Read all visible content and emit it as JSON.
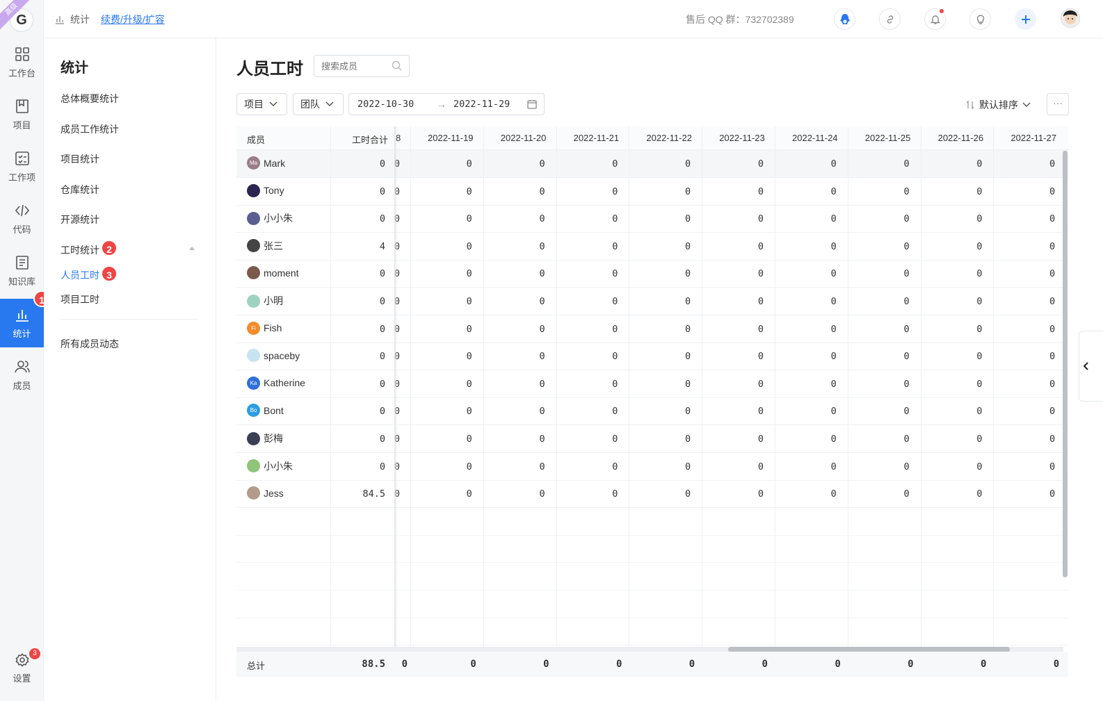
{
  "rail": {
    "badge_ribbon": "高级",
    "logo": "G",
    "items": [
      {
        "label": "工作台",
        "icon": "dashboard-icon"
      },
      {
        "label": "项目",
        "icon": "project-icon"
      },
      {
        "label": "工作项",
        "icon": "task-list-icon"
      },
      {
        "label": "代码",
        "icon": "code-icon"
      },
      {
        "label": "知识库",
        "icon": "document-icon"
      },
      {
        "label": "统计",
        "icon": "bar-chart-icon",
        "active": true
      },
      {
        "label": "成员",
        "icon": "members-icon"
      }
    ],
    "settings_label": "设置",
    "settings_badge": "3",
    "step_badge_1": "1"
  },
  "header": {
    "breadcrumb_label": "统计",
    "upgrade_link": "续费/升级/扩容",
    "qq_group": "售后 QQ 群：732702389"
  },
  "sidebar": {
    "title": "统计",
    "items": [
      "总体概要统计",
      "成员工作统计",
      "项目统计",
      "仓库统计",
      "开源统计",
      "工时统计",
      "人员工时",
      "项目工时",
      "所有成员动态"
    ],
    "step_badge_2": "2",
    "step_badge_3": "3"
  },
  "main": {
    "title": "人员工时",
    "search_placeholder": "搜索成员",
    "filter_project": "项目",
    "filter_team": "团队",
    "date_start": "2022-10-30",
    "date_arrow": "→",
    "date_end": "2022-11-29",
    "sort_label": "默认排序",
    "more_label": "···"
  },
  "table": {
    "col_member": "成员",
    "col_total": "工时合计",
    "partial_col": "8",
    "dates": [
      "2022-11-19",
      "2022-11-20",
      "2022-11-21",
      "2022-11-22",
      "2022-11-23",
      "2022-11-24",
      "2022-11-25",
      "2022-11-26",
      "2022-11-27"
    ],
    "rows": [
      {
        "name": "Mark",
        "avatar": "Ma",
        "color": "#9a7d86",
        "total": "0"
      },
      {
        "name": "Tony",
        "avatar": "",
        "color": "#2b2550",
        "total": "0"
      },
      {
        "name": "小小朱",
        "avatar": "",
        "color": "#5a5f8f",
        "total": "0"
      },
      {
        "name": "张三",
        "avatar": "",
        "color": "#444444",
        "total": "4"
      },
      {
        "name": "moment",
        "avatar": "",
        "color": "#7a5a4a",
        "total": "0"
      },
      {
        "name": "小明",
        "avatar": "",
        "color": "#9fd3c0",
        "total": "0"
      },
      {
        "name": "Fish",
        "avatar": "Fi",
        "color": "#f28b2c",
        "total": "0"
      },
      {
        "name": "spaceby",
        "avatar": "",
        "color": "#c8e4f0",
        "total": "0"
      },
      {
        "name": "Katherine",
        "avatar": "Ka",
        "color": "#2f6fd8",
        "total": "0"
      },
      {
        "name": "Bont",
        "avatar": "Bo",
        "color": "#2b9de0",
        "total": "0"
      },
      {
        "name": "彭梅",
        "avatar": "",
        "color": "#3a3f55",
        "total": "0"
      },
      {
        "name": "小小朱",
        "avatar": "",
        "color": "#8fc47a",
        "total": "0"
      },
      {
        "name": "Jess",
        "avatar": "",
        "color": "#b49a8a",
        "total": "84.5"
      }
    ],
    "cell_value": "0",
    "footer_label": "总计",
    "footer_total": "88.5",
    "footer_value": "0"
  }
}
